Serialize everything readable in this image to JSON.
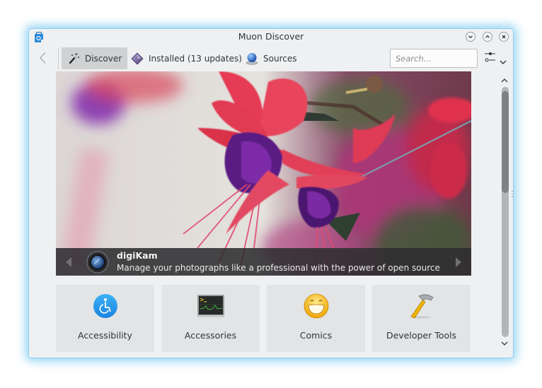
{
  "window": {
    "title": "Muon Discover",
    "app_icon": "muon-discover-bag-icon",
    "controls": [
      "minimize-icon",
      "maximize-icon",
      "close-icon"
    ]
  },
  "toolbar": {
    "back_icon": "chevron-left-icon",
    "tabs": [
      {
        "label": "Discover",
        "icon": "magic-wand-icon",
        "active": true
      },
      {
        "label": "Installed (13 updates)",
        "icon": "diamond-package-icon",
        "active": false
      },
      {
        "label": "Sources",
        "icon": "globe-network-icon",
        "active": false
      }
    ],
    "search": {
      "placeholder": "Search...",
      "value": ""
    },
    "menu_icon": "settings-sliders-icon"
  },
  "featured": {
    "app_name": "digiKam",
    "description": "Manage your photographs like a professional with the power of open source",
    "icon": "camera-lens-icon",
    "prev_icon": "triangle-left-icon",
    "next_icon": "triangle-right-icon"
  },
  "categories": [
    {
      "label": "Accessibility",
      "icon": "wheelchair-icon"
    },
    {
      "label": "Accessories",
      "icon": "terminal-monitor-icon"
    },
    {
      "label": "Comics",
      "icon": "grinning-face-icon"
    },
    {
      "label": "Developer Tools",
      "icon": "hammer-icon"
    }
  ],
  "scrollbar": {
    "position_fraction": 0.0,
    "visible_fraction": 0.41
  },
  "colors": {
    "window_bg": "#eff0f1",
    "window_glow": "#3daee9",
    "active_tab": "#cfd1d3",
    "category_tile": "#e3e4e5",
    "text": "#31363b"
  }
}
